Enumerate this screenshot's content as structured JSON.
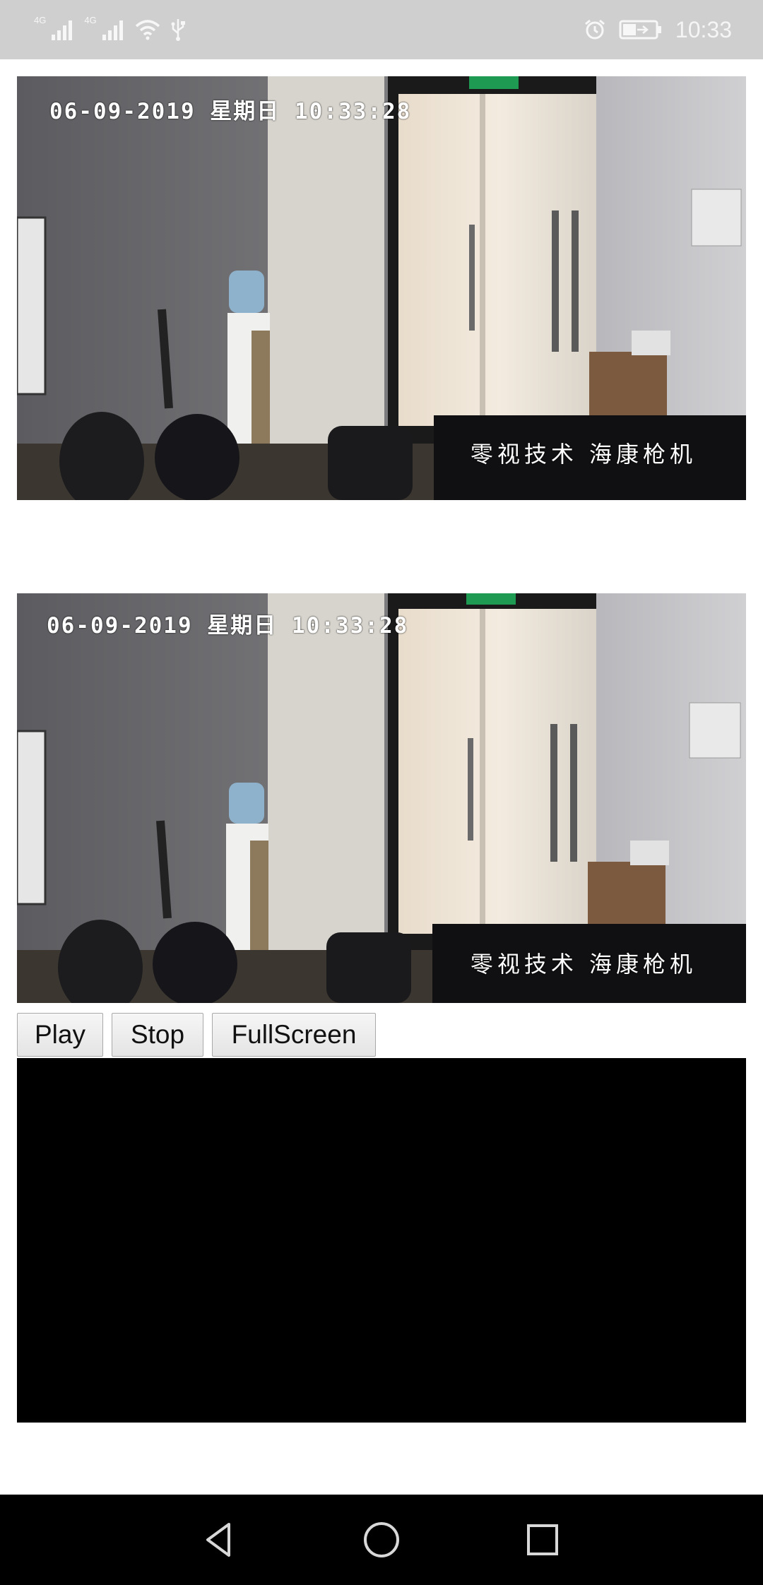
{
  "status_bar": {
    "net1": "4G",
    "net2": "4G",
    "icons": [
      "signal-icon",
      "signal-icon",
      "wifi-icon",
      "usb-icon",
      "alarm-icon",
      "battery-charging-icon"
    ],
    "time": "10:33"
  },
  "camera_top": {
    "osd_time": "06-09-2019 星期日 10:33:28",
    "osd_caption": "零视技术 海康枪机"
  },
  "camera_mid": {
    "osd_time": "06-09-2019 星期日 10:33:28",
    "osd_caption": "零视技术 海康枪机"
  },
  "controls": {
    "play_label": "Play",
    "stop_label": "Stop",
    "fullscreen_label": "FullScreen"
  },
  "player": {
    "state": "black"
  },
  "nav_bar": {
    "icons": [
      "back-icon",
      "home-icon",
      "recents-icon"
    ]
  }
}
